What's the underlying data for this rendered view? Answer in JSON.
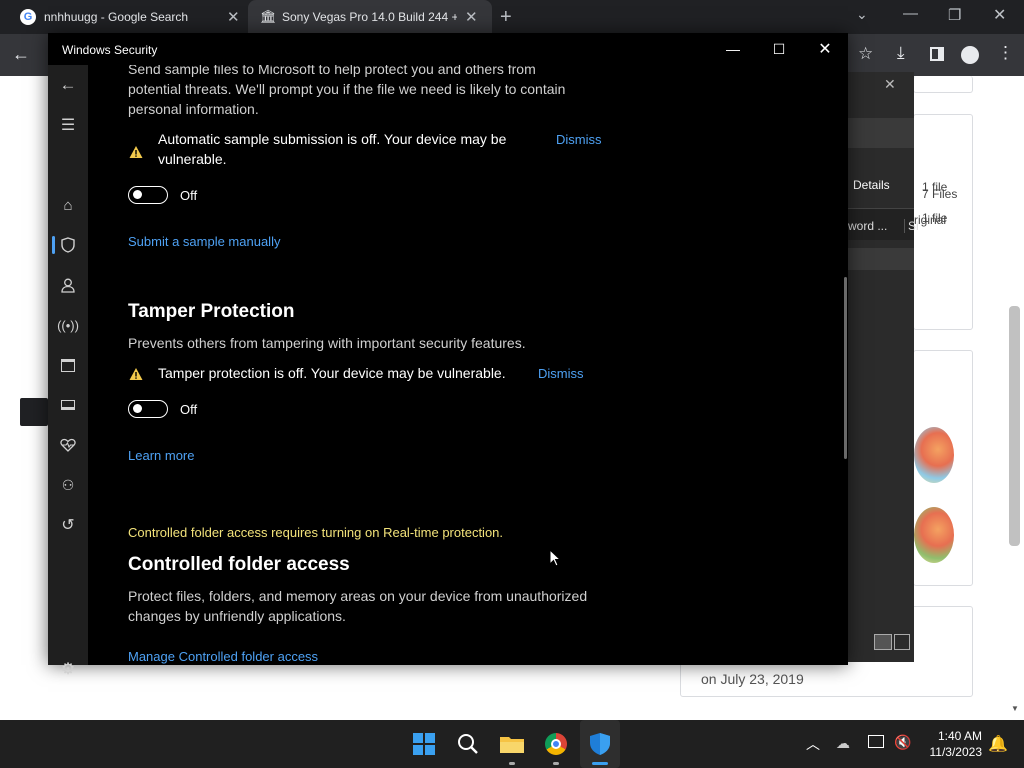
{
  "browser": {
    "tabs": [
      {
        "title": "nnhhuugg - Google Search"
      },
      {
        "title": "Sony Vegas Pro 14.0 Build 244 +"
      }
    ],
    "background": {
      "details_label": "Details",
      "file_count_1": "1 file",
      "file_count_2": "1 file",
      "col_word": "word ...",
      "col_size": "Si",
      "files_text": "7 Files",
      "original_text": "riginal",
      "date_text": "on July 23, 2019"
    }
  },
  "window": {
    "title": "Windows Security"
  },
  "content": {
    "sample_text_line1": "Send sample files to Microsoft to help protect you and others from",
    "sample_text_line2": "potential threats. We'll prompt you if the file we need is likely to contain",
    "sample_text_line3": "personal information.",
    "auto_warning_line1": "Automatic sample submission is off. Your device may be",
    "auto_warning_line2": "vulnerable.",
    "dismiss_label": "Dismiss",
    "toggle_off_label": "Off",
    "submit_link": "Submit a sample manually",
    "tamper_title": "Tamper Protection",
    "tamper_desc": "Prevents others from tampering with important security features.",
    "tamper_warning": "Tamper protection is off. Your device may be vulnerable.",
    "learn_more": "Learn more",
    "cfa_notice": "Controlled folder access requires turning on Real-time protection.",
    "cfa_title": "Controlled folder access",
    "cfa_desc_line1": "Protect files, folders, and memory areas on your device from unauthorized",
    "cfa_desc_line2": "changes by unfriendly applications.",
    "cfa_link": "Manage Controlled folder access"
  },
  "colors": {
    "link": "#4ea1f3",
    "warning": "#f2c94c",
    "notice": "#f2e27a"
  },
  "taskbar": {
    "time": "1:40 AM",
    "date": "11/3/2023"
  }
}
